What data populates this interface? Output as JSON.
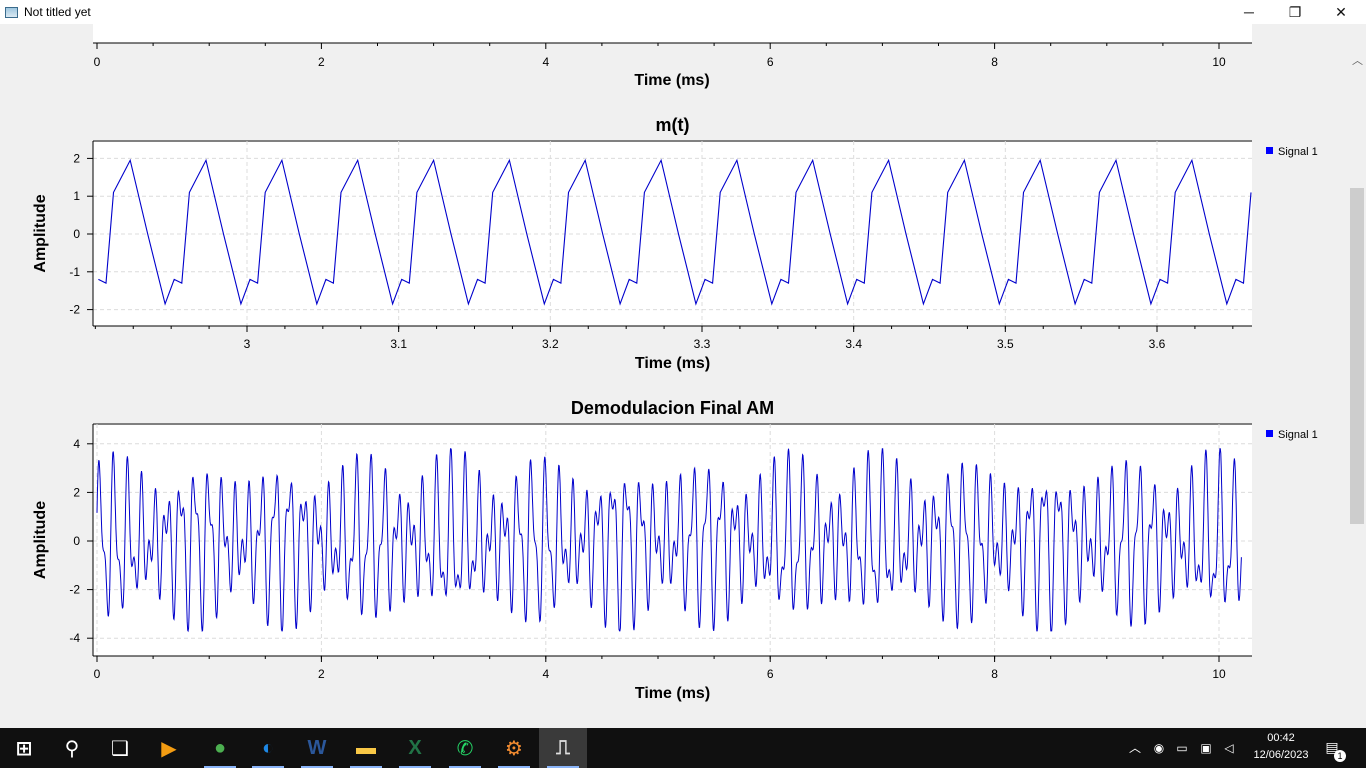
{
  "window": {
    "title": "Not titled yet",
    "minimize_glyph": "─",
    "maximize_glyph": "❐",
    "close_glyph": "✕"
  },
  "colors": {
    "signal": "#0000cc",
    "plot_bg": "#ffffff",
    "panel_bg": "#f0f0f0",
    "taskbar": "#101010",
    "legend_marker": "#0000ff"
  },
  "top_partial_plot": {
    "xlabel": "Time (ms)",
    "ticks": [
      "0",
      "2",
      "4",
      "6",
      "8",
      "10"
    ]
  },
  "chart_data": [
    {
      "type": "line",
      "title": "m(t)",
      "xlabel": "Time (ms)",
      "ylabel": "Amplitude",
      "xlim": [
        2.9,
        3.665
      ],
      "ylim": [
        -2.2,
        2.4
      ],
      "x_ticks": [
        "3",
        "3.1",
        "3.2",
        "3.3",
        "3.4",
        "3.5",
        "3.6"
      ],
      "y_ticks": [
        "2",
        "1",
        "0",
        "-1",
        "-2"
      ],
      "grid": true,
      "legend": "right",
      "series": [
        {
          "name": "Signal 1",
          "waveform": "triangle",
          "period_ms": 0.05,
          "peak": 1.95,
          "trough": -1.85,
          "first_peak_ms": 2.923
        }
      ]
    },
    {
      "type": "line",
      "title": "Demodulacion Final AM",
      "xlabel": "Time (ms)",
      "ylabel": "Amplitude",
      "xlim": [
        -0.1,
        10.25
      ],
      "ylim": [
        -4.6,
        4.6
      ],
      "x_ticks": [
        "0",
        "2",
        "4",
        "6",
        "8",
        "10"
      ],
      "y_ticks": [
        "4",
        "2",
        "0",
        "-2",
        "-4"
      ],
      "grid": true,
      "legend": "right",
      "series": [
        {
          "name": "Signal 1",
          "waveform": "multitone",
          "max_value": 3.8,
          "min_value": -3.7
        }
      ]
    }
  ],
  "taskbar": {
    "apps": [
      {
        "name": "start",
        "glyph": "⊞"
      },
      {
        "name": "search",
        "glyph": "⚲"
      },
      {
        "name": "task-view",
        "glyph": "❑"
      },
      {
        "name": "media-player",
        "glyph": "▶"
      },
      {
        "name": "chrome",
        "glyph": "●"
      },
      {
        "name": "edge",
        "glyph": "◐"
      },
      {
        "name": "word",
        "glyph": "W"
      },
      {
        "name": "file-explorer",
        "glyph": "▬"
      },
      {
        "name": "excel",
        "glyph": "X"
      },
      {
        "name": "whatsapp",
        "glyph": "✆"
      },
      {
        "name": "gnuradio",
        "glyph": "⚙"
      },
      {
        "name": "plot-app",
        "glyph": "⎍"
      }
    ],
    "time": "00:42",
    "date": "12/06/2023",
    "notification_count": "1"
  }
}
